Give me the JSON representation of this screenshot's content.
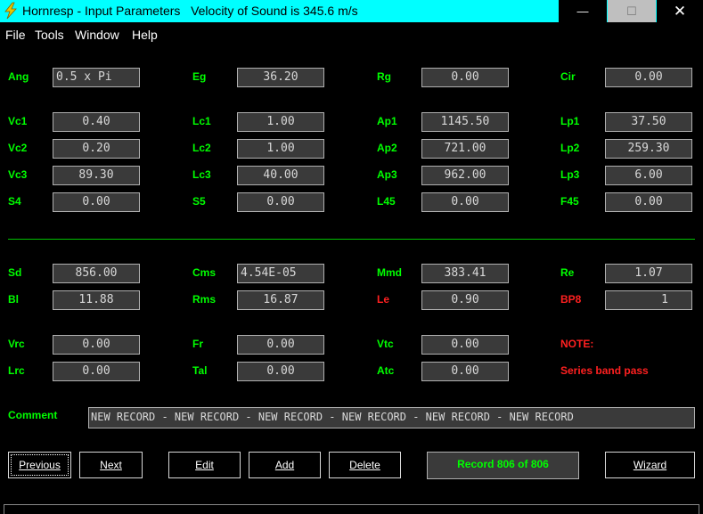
{
  "window": {
    "title": "Hornresp - Input Parameters   Velocity of Sound is 345.6 m/s",
    "minimize": "—",
    "maximize": "☐",
    "close": "✕",
    "icon": "lightning-icon"
  },
  "menu": {
    "file": "File",
    "tools": "Tools",
    "window": "Window",
    "help": "Help"
  },
  "params": {
    "ang": {
      "label": "Ang",
      "value": "0.5 x Pi"
    },
    "eg": {
      "label": "Eg",
      "value": "36.20"
    },
    "rg": {
      "label": "Rg",
      "value": "0.00"
    },
    "cir": {
      "label": "Cir",
      "value": "0.00"
    },
    "vc1": {
      "label": "Vc1",
      "value": "0.40"
    },
    "lc1": {
      "label": "Lc1",
      "value": "1.00"
    },
    "ap1": {
      "label": "Ap1",
      "value": "1145.50"
    },
    "lp1": {
      "label": "Lp1",
      "value": "37.50"
    },
    "vc2": {
      "label": "Vc2",
      "value": "0.20"
    },
    "lc2": {
      "label": "Lc2",
      "value": "1.00"
    },
    "ap2": {
      "label": "Ap2",
      "value": "721.00"
    },
    "lp2": {
      "label": "Lp2",
      "value": "259.30"
    },
    "vc3": {
      "label": "Vc3",
      "value": "89.30"
    },
    "lc3": {
      "label": "Lc3",
      "value": "40.00"
    },
    "ap3": {
      "label": "Ap3",
      "value": "962.00"
    },
    "lp3": {
      "label": "Lp3",
      "value": "6.00"
    },
    "s4": {
      "label": "S4",
      "value": "0.00"
    },
    "s5": {
      "label": "S5",
      "value": "0.00"
    },
    "l45": {
      "label": "L45",
      "value": "0.00"
    },
    "f45": {
      "label": "F45",
      "value": "0.00"
    },
    "sd": {
      "label": "Sd",
      "value": "856.00"
    },
    "cms": {
      "label": "Cms",
      "value": "4.54E-05"
    },
    "mmd": {
      "label": "Mmd",
      "value": "383.41"
    },
    "re": {
      "label": "Re",
      "value": "1.07"
    },
    "bl": {
      "label": "Bl",
      "value": "11.88"
    },
    "rms": {
      "label": "Rms",
      "value": "16.87"
    },
    "le": {
      "label": "Le",
      "value": "0.90"
    },
    "bp8": {
      "label": "BP8",
      "value": "1"
    },
    "vrc": {
      "label": "Vrc",
      "value": "0.00"
    },
    "fr": {
      "label": "Fr",
      "value": "0.00"
    },
    "vtc": {
      "label": "Vtc",
      "value": "0.00"
    },
    "lrc": {
      "label": "Lrc",
      "value": "0.00"
    },
    "tal": {
      "label": "Tal",
      "value": "0.00"
    },
    "atc": {
      "label": "Atc",
      "value": "0.00"
    }
  },
  "note": {
    "label": "NOTE:",
    "text": "Series band pass"
  },
  "comment": {
    "label": "Comment",
    "value": "NEW RECORD - NEW RECORD - NEW RECORD - NEW RECORD - NEW RECORD - NEW RECORD"
  },
  "buttons": {
    "previous": "Previous",
    "next": "Next",
    "edit": "Edit",
    "add": "Add",
    "delete": "Delete",
    "wizard": "Wizard"
  },
  "record_status": "Record 806 of 806",
  "colors": {
    "title_bar": "#00ffff",
    "background": "#000000",
    "label_green": "#00ff00",
    "label_red": "#ff2020",
    "field_bg": "#3a3a3a"
  }
}
